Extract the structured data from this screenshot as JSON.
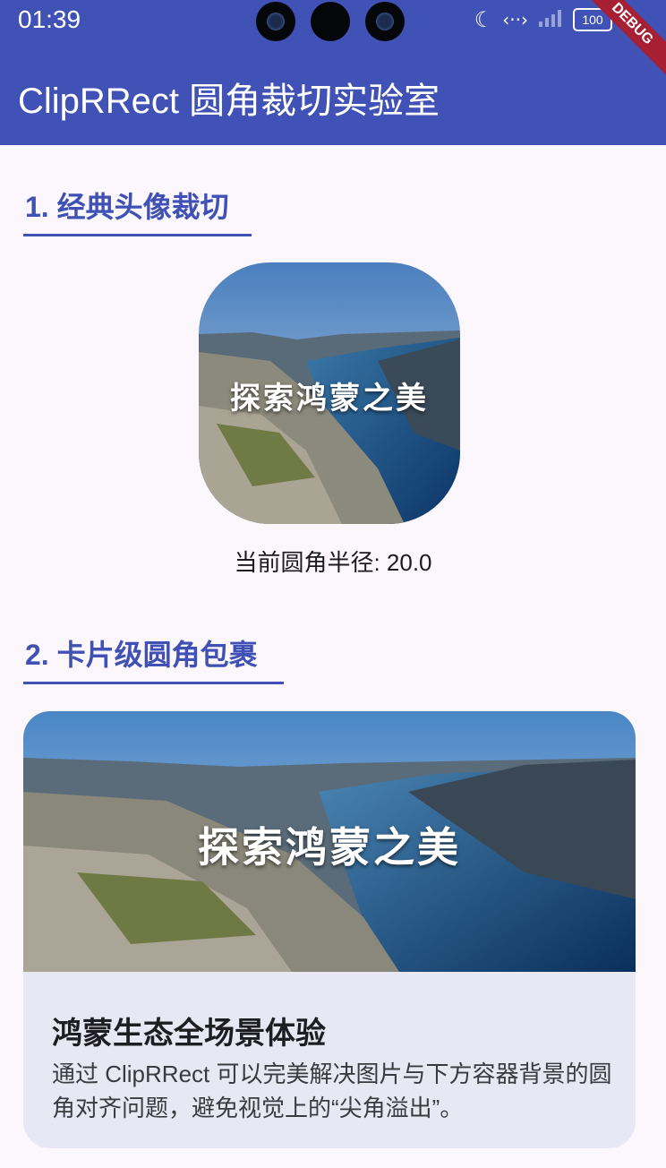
{
  "status_bar": {
    "time": "01:39",
    "battery": "100"
  },
  "debug_banner": "DEBUG",
  "app_bar": {
    "title": "ClipRRect 圆角裁切实验室"
  },
  "section1": {
    "title": "1. 经典头像裁切",
    "image_caption": "探索鸿蒙之美",
    "radius_label": "当前圆角半径: 20.0"
  },
  "section2": {
    "title": "2. 卡片级圆角包裹",
    "image_caption": "探索鸿蒙之美",
    "card_title": "鸿蒙生态全场景体验",
    "card_description": "通过 ClipRRect 可以完美解决图片与下方容器背景的圆角对齐问题，避免视觉上的“尖角溢出”。"
  },
  "colors": {
    "app_bar": "#4052b6",
    "accent": "#3f51b5",
    "background": "#fcf7fd",
    "card_background": "#e8e8f5"
  }
}
